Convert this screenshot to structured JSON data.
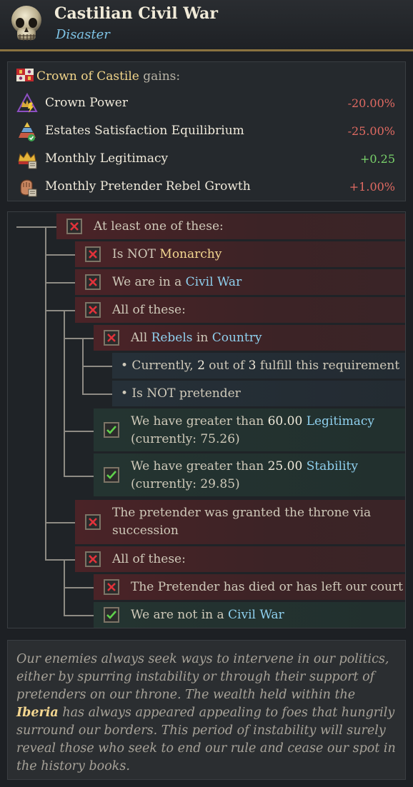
{
  "header": {
    "title": "Castilian Civil War",
    "subtitle": "Disaster"
  },
  "modifiers": {
    "country": "Crown of Castile",
    "gains_label": "gains:",
    "items": [
      {
        "label": "Crown Power",
        "value": "-20.00%",
        "icon": "crown-power-icon"
      },
      {
        "label": "Estates Satisfaction Equilibrium",
        "value": "-25.00%",
        "icon": "estates-pyramid-icon"
      },
      {
        "label": "Monthly Legitimacy",
        "value": "+0.25",
        "icon": "legitimacy-crown-icon"
      },
      {
        "label": "Monthly Pretender Rebel Growth",
        "value": "+1.00%",
        "icon": "rebel-fist-icon"
      }
    ]
  },
  "trigger": {
    "r1": "At least one of these:",
    "r2_pre": "Is NOT ",
    "r2_hl": "Monarchy",
    "r3_pre": "We are in a ",
    "r3_hl": "Civil War",
    "r4": "All of these:",
    "r5_pre": "All ",
    "r5_hl1": "Rebels",
    "r5_mid": " in ",
    "r5_hl2": "Country",
    "r6_pre": "• Currently, ",
    "r6_n1": "2",
    "r6_mid": " out of ",
    "r6_n2": "3",
    "r6_post": " fulfill this requirement",
    "r7": "• Is NOT pretender",
    "r8_pre": "We have greater than ",
    "r8_num": "60.00",
    "r8_hl": "Legitimacy",
    "r8_cur": "(currently: 75.26)",
    "r9_pre": "We have greater than ",
    "r9_num": "25.00",
    "r9_hl": "Stability",
    "r9_cur": "(currently: 29.85)",
    "r10_l1": "The pretender was granted the throne via",
    "r10_l2": "succession",
    "r11": "All of these:",
    "r12": "The Pretender has died or has left our court",
    "r13_pre": "We are not in a ",
    "r13_hl": "Civil War"
  },
  "description": {
    "pre": "Our enemies always seek ways to intervene in our politics, either by spurring instability or through their support of pretenders on our throne. The wealth held within the ",
    "hl": "Iberia",
    "post": " has always appeared appealing to foes that hungrily surround our borders. This period of instability will surely reveal those who seek to end our rule and cease our spot in the history books."
  }
}
